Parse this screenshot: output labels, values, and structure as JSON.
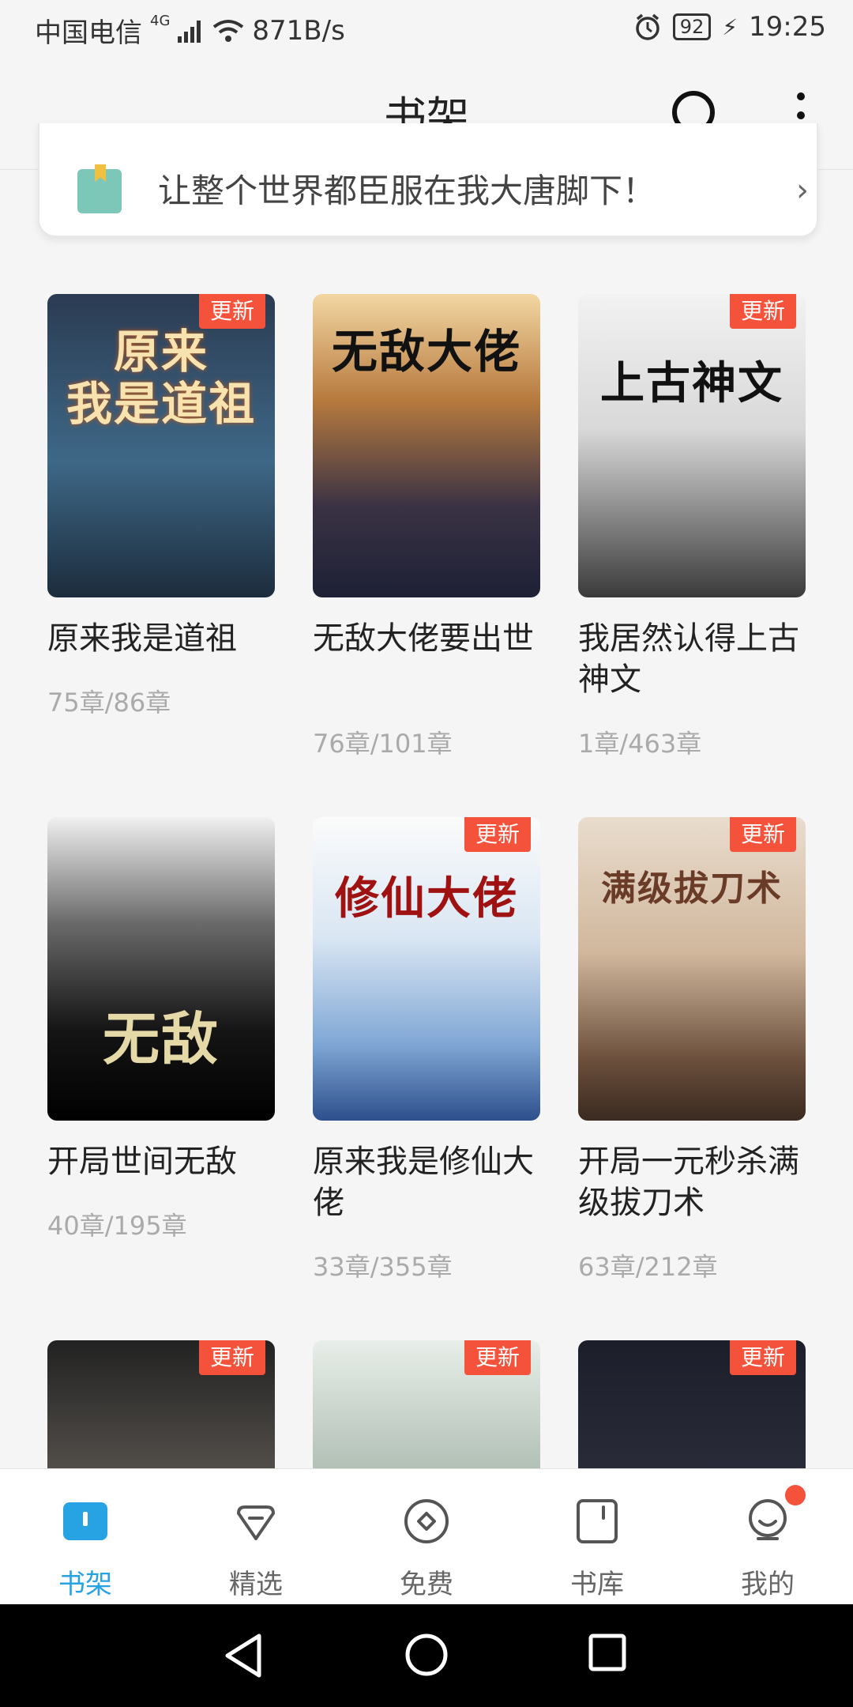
{
  "status_bar": {
    "carrier": "中国电信",
    "network": "4G",
    "speed": "871B/s",
    "battery": "92",
    "time": "19:25"
  },
  "header": {
    "title": "书架"
  },
  "banner": {
    "text": "让整个世界都臣服在我大唐脚下！"
  },
  "update_badge": "更新",
  "books": [
    {
      "name": "原来我是道祖",
      "progress": "75章/86章",
      "updated": true,
      "cover_text": "原来\n我是道祖",
      "cover_color": "#2f4a63"
    },
    {
      "name": "无敌大佬要出世",
      "progress": "76章/101章",
      "updated": false,
      "cover_text": "无敌大佬",
      "cover_color": "#3a3244"
    },
    {
      "name": "我居然认得上古神文",
      "progress": "1章/463章",
      "updated": true,
      "cover_text": "上古神文",
      "cover_color": "#d9d9d9"
    },
    {
      "name": "开局世间无敌",
      "progress": "40章/195章",
      "updated": false,
      "cover_text": "无敌",
      "cover_color": "#1b1b1b"
    },
    {
      "name": "原来我是修仙大佬",
      "progress": "33章/355章",
      "updated": true,
      "cover_text": "修仙大佬",
      "cover_color": "#9ab9da"
    },
    {
      "name": "开局一元秒杀满级拔刀术",
      "progress": "63章/212章",
      "updated": true,
      "cover_text": "满级拔刀术",
      "cover_color": "#c7a98c"
    },
    {
      "name": "",
      "progress": "",
      "updated": true,
      "cover_text": "",
      "cover_color": "#5a5550"
    },
    {
      "name": "",
      "progress": "",
      "updated": true,
      "cover_text": "",
      "cover_color": "#a8b8ad"
    },
    {
      "name": "",
      "progress": "",
      "updated": true,
      "cover_text": "",
      "cover_color": "#2b2d3c"
    }
  ],
  "bottom_nav": [
    {
      "label": "书架",
      "icon": "bookshelf-icon",
      "active": true
    },
    {
      "label": "精选",
      "icon": "diamond-icon",
      "active": false
    },
    {
      "label": "免费",
      "icon": "free-icon",
      "active": false
    },
    {
      "label": "书库",
      "icon": "library-icon",
      "active": false
    },
    {
      "label": "我的",
      "icon": "profile-icon",
      "active": false,
      "notification": true
    }
  ],
  "colors": {
    "accent": "#27a3e4",
    "badge": "#f4523b"
  }
}
